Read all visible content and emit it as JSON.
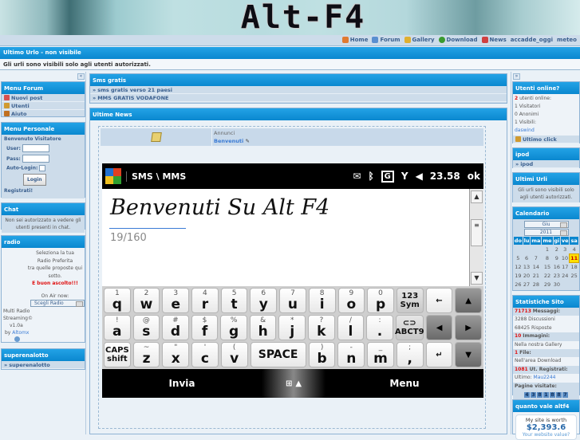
{
  "banner": {
    "logo": "Alt-F4"
  },
  "nav": {
    "links": [
      {
        "label": "Home",
        "icon": "home-icon",
        "color": "#e07a30"
      },
      {
        "label": "Forum",
        "icon": "forum-icon",
        "color": "#5a8fd0"
      },
      {
        "label": "Gallery",
        "icon": "gallery-icon",
        "color": "#e0b030"
      },
      {
        "label": "Download",
        "icon": "download-icon",
        "color": "#3a9a30"
      },
      {
        "label": "News",
        "icon": "news-icon",
        "color": "#d04040"
      },
      {
        "label": "accadde_oggi",
        "icon": "",
        "color": ""
      },
      {
        "label": "meteo",
        "icon": "",
        "color": ""
      }
    ]
  },
  "urlo": {
    "title": "Ultimo Urlo - non visibile",
    "body": "Gli urli sono visibili solo agli utenti autorizzati."
  },
  "toggles": {
    "left": "«",
    "right": "»"
  },
  "left": {
    "menu_forum": {
      "title": "Menu Forum",
      "items": [
        "Nuovi post",
        "Utenti",
        "Aiuto"
      ]
    },
    "menu_personale": {
      "title": "Menu Personale",
      "welcome": "Benvenuto Visitatore",
      "user_label": "User:",
      "pass_label": "Pass:",
      "autologin_label": "Auto-Login:",
      "login_button": "Login",
      "register_link": "Registrati!"
    },
    "chat": {
      "title": "Chat",
      "text": "Non sei autorizzato a vedere gli utenti presenti in chat."
    },
    "radio": {
      "title": "radio",
      "line1": "Seleziona la tua",
      "line2": "Radio Preferita",
      "line3": "tra quelle proposte qui",
      "line4": "sotto.",
      "greeting": "E buon ascolto!!!",
      "on_air": "On Air now:",
      "select_value": "Scegli Radio",
      "credit1": "Multi Radio",
      "credit2": "Streaming©",
      "version": "v1.0a",
      "by": "by",
      "author": "Altomx"
    },
    "superenalotto": {
      "title": "superenalotto",
      "item": "superenalotto"
    }
  },
  "mid": {
    "sms": {
      "title": "Sms gratis",
      "items": [
        "sms gratis verso 21 paesi",
        "MMS GRATIS VODAFONE"
      ]
    },
    "news": {
      "title": "Ultime News",
      "category": "Annunci",
      "topic": "Benvenuti"
    },
    "phone": {
      "app_title": "SMS \\ MMS",
      "time": "23.58",
      "ok": "ok",
      "message": "Benvenuti Su Alt F4",
      "counter": "19/160",
      "keys_row1": [
        {
          "s": "1",
          "m": "q"
        },
        {
          "s": "2",
          "m": "w"
        },
        {
          "s": "3",
          "m": "e"
        },
        {
          "s": "4",
          "m": "r"
        },
        {
          "s": "5",
          "m": "t"
        },
        {
          "s": "6",
          "m": "y"
        },
        {
          "s": "7",
          "m": "u"
        },
        {
          "s": "8",
          "m": "i"
        },
        {
          "s": "9",
          "m": "o"
        },
        {
          "s": "0",
          "m": "p"
        }
      ],
      "keys_row2": [
        {
          "s": "!",
          "m": "a"
        },
        {
          "s": "@",
          "m": "s"
        },
        {
          "s": "#",
          "m": "d"
        },
        {
          "s": "$",
          "m": "f"
        },
        {
          "s": "%",
          "m": "g"
        },
        {
          "s": "&",
          "m": "h"
        },
        {
          "s": "*",
          "m": "j"
        },
        {
          "s": "?",
          "m": "k"
        },
        {
          "s": "/",
          "m": "l"
        },
        {
          "s": ":",
          "m": "."
        }
      ],
      "keys_row3": [
        {
          "s": "~",
          "m": "z"
        },
        {
          "s": "\"",
          "m": "x"
        },
        {
          "s": "'",
          "m": "c"
        },
        {
          "s": "(",
          "m": "v"
        }
      ],
      "keys_row3b": [
        {
          "s": ")",
          "m": "b"
        },
        {
          "s": "-",
          "m": "n"
        },
        {
          "s": "_",
          "m": "m"
        },
        {
          "s": ";",
          "m": ","
        }
      ],
      "sym_top": "123",
      "sym_bottom": "Sym",
      "abc_label": "ABCT9",
      "caps_top": "CAPS",
      "caps_bottom": "shift",
      "space": "SPACE",
      "softkey_left": "Invia",
      "softkey_right": "Menu"
    }
  },
  "right": {
    "online": {
      "title": "Utenti online?",
      "count": "2",
      "count_label": "utenti online:",
      "visitors": "1  Visitatori",
      "anon": "0  Anonimi",
      "visible": "1  Visibili:",
      "user": "daswind",
      "last_click": "Ultimo click"
    },
    "ipod": {
      "title": "ipod",
      "item": "ipod"
    },
    "ultimi_urli": {
      "title": "Ultimi Urli",
      "text": "Gli urli sono visibili solo agli utenti autorizzati."
    },
    "calendar": {
      "title": "Calendario",
      "month": "Giu",
      "year": "2011",
      "days": [
        "do",
        "lu",
        "ma",
        "me",
        "gi",
        "ve",
        "sa"
      ],
      "weeks": [
        [
          "",
          "",
          "",
          "1",
          "2",
          "3",
          "4"
        ],
        [
          "5",
          "6",
          "7",
          "8",
          "9",
          "10",
          "11"
        ],
        [
          "12",
          "13",
          "14",
          "15",
          "16",
          "17",
          "18"
        ],
        [
          "19",
          "20",
          "21",
          "22",
          "23",
          "24",
          "25"
        ],
        [
          "26",
          "27",
          "28",
          "29",
          "30",
          "",
          ""
        ]
      ],
      "today": "11"
    },
    "stats": {
      "title": "Statistiche Sito",
      "messages_n": "71713",
      "messages_l": "Messaggi:",
      "discussions": "3288 Discussioni",
      "replies": "68425 Risposte",
      "images_n": "10",
      "images_l": "Immagini:",
      "gallery": "Nella nostra Gallery",
      "files_n": "1",
      "files_l": "File:",
      "download": "Nell'area Download",
      "reg_n": "1081",
      "reg_l": "Ut. Registrati:",
      "last_label": "Ultimo:",
      "last_user": "Mau2244",
      "visits_label": "Pagine visitate:",
      "visits": [
        "4",
        "3",
        "8",
        "1",
        "8",
        "8",
        "7"
      ]
    },
    "worth": {
      "title": "quanto vale altf4",
      "line1": "My site is worth",
      "value": "$2,393.6",
      "link": "Your website value?"
    }
  }
}
